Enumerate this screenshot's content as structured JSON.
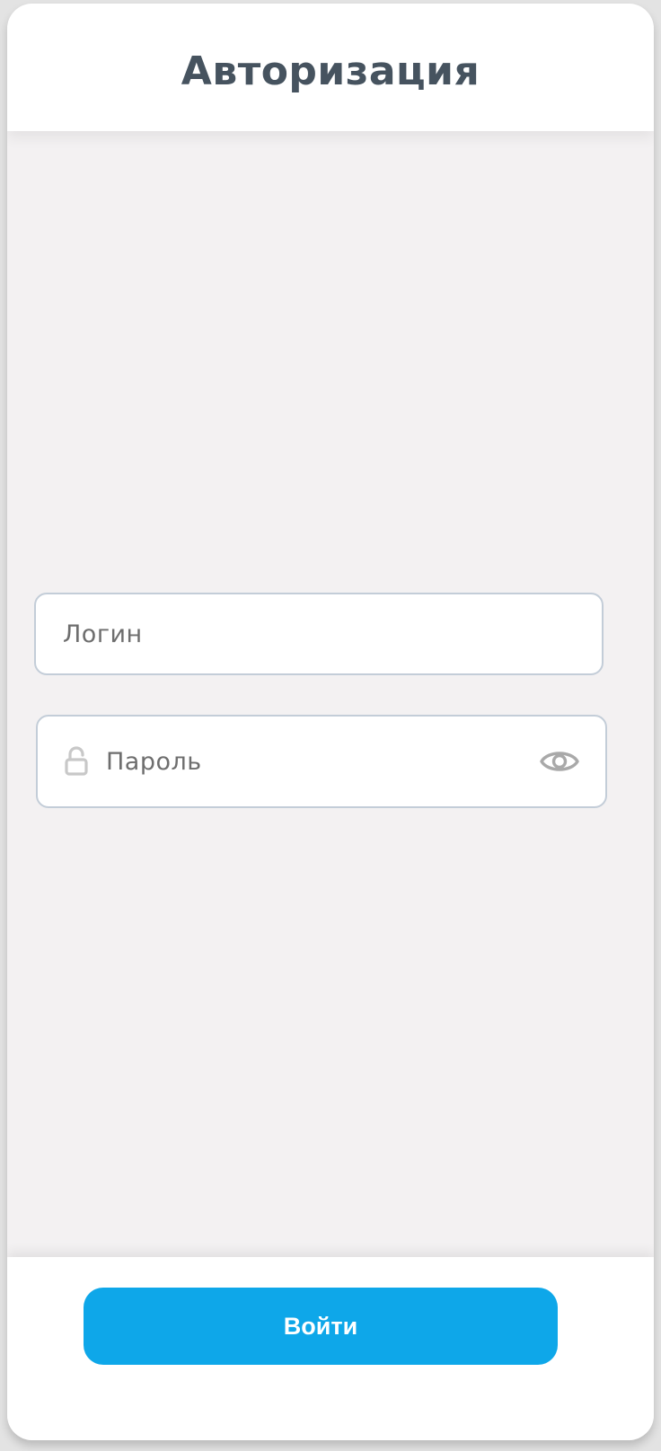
{
  "header": {
    "title": "Авторизация"
  },
  "login": {
    "placeholder": "Логин",
    "value": ""
  },
  "password": {
    "placeholder": "Пароль",
    "value": "",
    "lock_icon": "lock-open-icon",
    "toggle_icon": "eye-icon"
  },
  "footer": {
    "submit_label": "Войти"
  },
  "colors": {
    "accent": "#0ea7e9",
    "title": "#46535f",
    "background": "#f3f1f2",
    "field_border": "#c3cdd8"
  }
}
